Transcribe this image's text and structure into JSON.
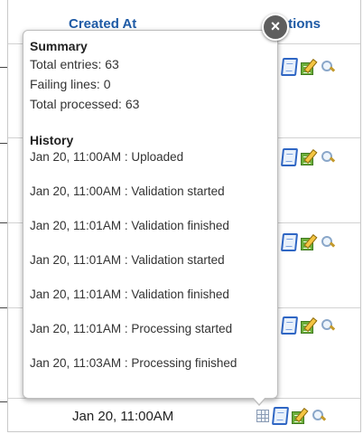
{
  "table": {
    "columns": [
      "Created At",
      "Actions"
    ],
    "last_row_created": "Jan 20, 11:00AM"
  },
  "popover": {
    "close_label": "×",
    "summary": {
      "title": "Summary",
      "lines": [
        "Total entries: 63",
        "Failing lines: 0",
        "Total processed: 63"
      ]
    },
    "history": {
      "title": "History",
      "items": [
        "Jan 20, 11:00AM : Uploaded",
        "Jan 20, 11:00AM : Validation started",
        "Jan 20, 11:01AM : Validation finished",
        "Jan 20, 11:01AM : Validation started",
        "Jan 20, 11:01AM : Validation finished",
        "Jan 20, 11:01AM : Processing started",
        "Jan 20, 11:03AM : Processing finished"
      ]
    }
  },
  "icons": {
    "view": "document-icon",
    "edit": "edit-icon",
    "inspect": "magnifier-icon",
    "details": "table-icon"
  },
  "colors": {
    "header_text": "#1e5aa5",
    "close_button": "#5e5e5e",
    "edit_green": "#6cae3a",
    "doc_blue": "#2f66c4"
  }
}
